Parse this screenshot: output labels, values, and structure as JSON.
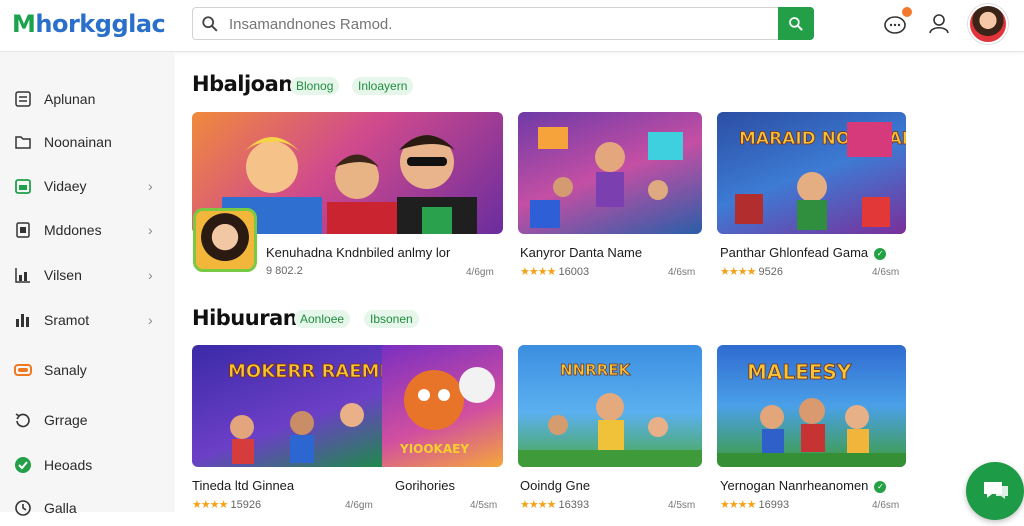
{
  "app": {
    "logo_m": "M",
    "logo_rest": "horkgglac"
  },
  "search": {
    "value": "",
    "placeholder": "Insamandnones Ramod."
  },
  "sidebar": {
    "items": [
      {
        "label": "Aplunan",
        "icon": "list-icon",
        "chevron": false
      },
      {
        "label": "Noonainan",
        "icon": "folder-icon",
        "chevron": false
      },
      {
        "label": "Vidaey",
        "icon": "calendar-icon",
        "chevron": true
      },
      {
        "label": "Mddones",
        "icon": "document-icon",
        "chevron": true
      },
      {
        "label": "Vilsen",
        "icon": "chart-icon",
        "chevron": true
      },
      {
        "label": "Sramot",
        "icon": "bar-chart-icon",
        "chevron": true
      },
      {
        "label": "Sanaly",
        "icon": "toggle-icon",
        "chevron": false
      },
      {
        "label": "Grrage",
        "icon": "recycle-icon",
        "chevron": false
      },
      {
        "label": "Heoads",
        "icon": "check-circle-icon",
        "chevron": false
      },
      {
        "label": "Galla",
        "icon": "clock-icon",
        "chevron": false
      }
    ]
  },
  "sections": [
    {
      "title": "Hbaljoan",
      "tags": [
        "Blonog",
        "Inloayern"
      ],
      "cards": [
        {
          "title": "Kenuhadna Kndnbiled anlmy lor",
          "rating": "9 802.2",
          "downloads": "4/6gm"
        },
        {
          "title": "Kanyror Danta Name",
          "rating": "16003",
          "downloads": "4/6sm"
        },
        {
          "title": "Panthar Ghlonfead Gama",
          "rating": "9526",
          "downloads": "4/6sm"
        }
      ]
    },
    {
      "title": "Hibuuran",
      "tags": [
        "Aonloee",
        "Ibsonen"
      ],
      "cards": [
        {
          "title": "Tineda ltd Ginnea",
          "rating": "15926",
          "downloads": "4/6gm"
        },
        {
          "title": "Gorihories",
          "rating": "",
          "downloads": "4/5sm"
        },
        {
          "title": "Ooindg Gne",
          "rating": "16393",
          "downloads": "4/5sm"
        },
        {
          "title": "Yernogan Nanrheanomen",
          "rating": "16993",
          "downloads": "4/6sm"
        }
      ]
    }
  ],
  "banners": [
    "MARAID NOHPEAN",
    "MOKERR RAEMEK",
    "YIOOKAEY",
    "NNRREK",
    "MALEESY"
  ],
  "colors": {
    "accent": "#23a047",
    "brand_blue": "#2a6fc9",
    "star": "#f2a31a"
  }
}
